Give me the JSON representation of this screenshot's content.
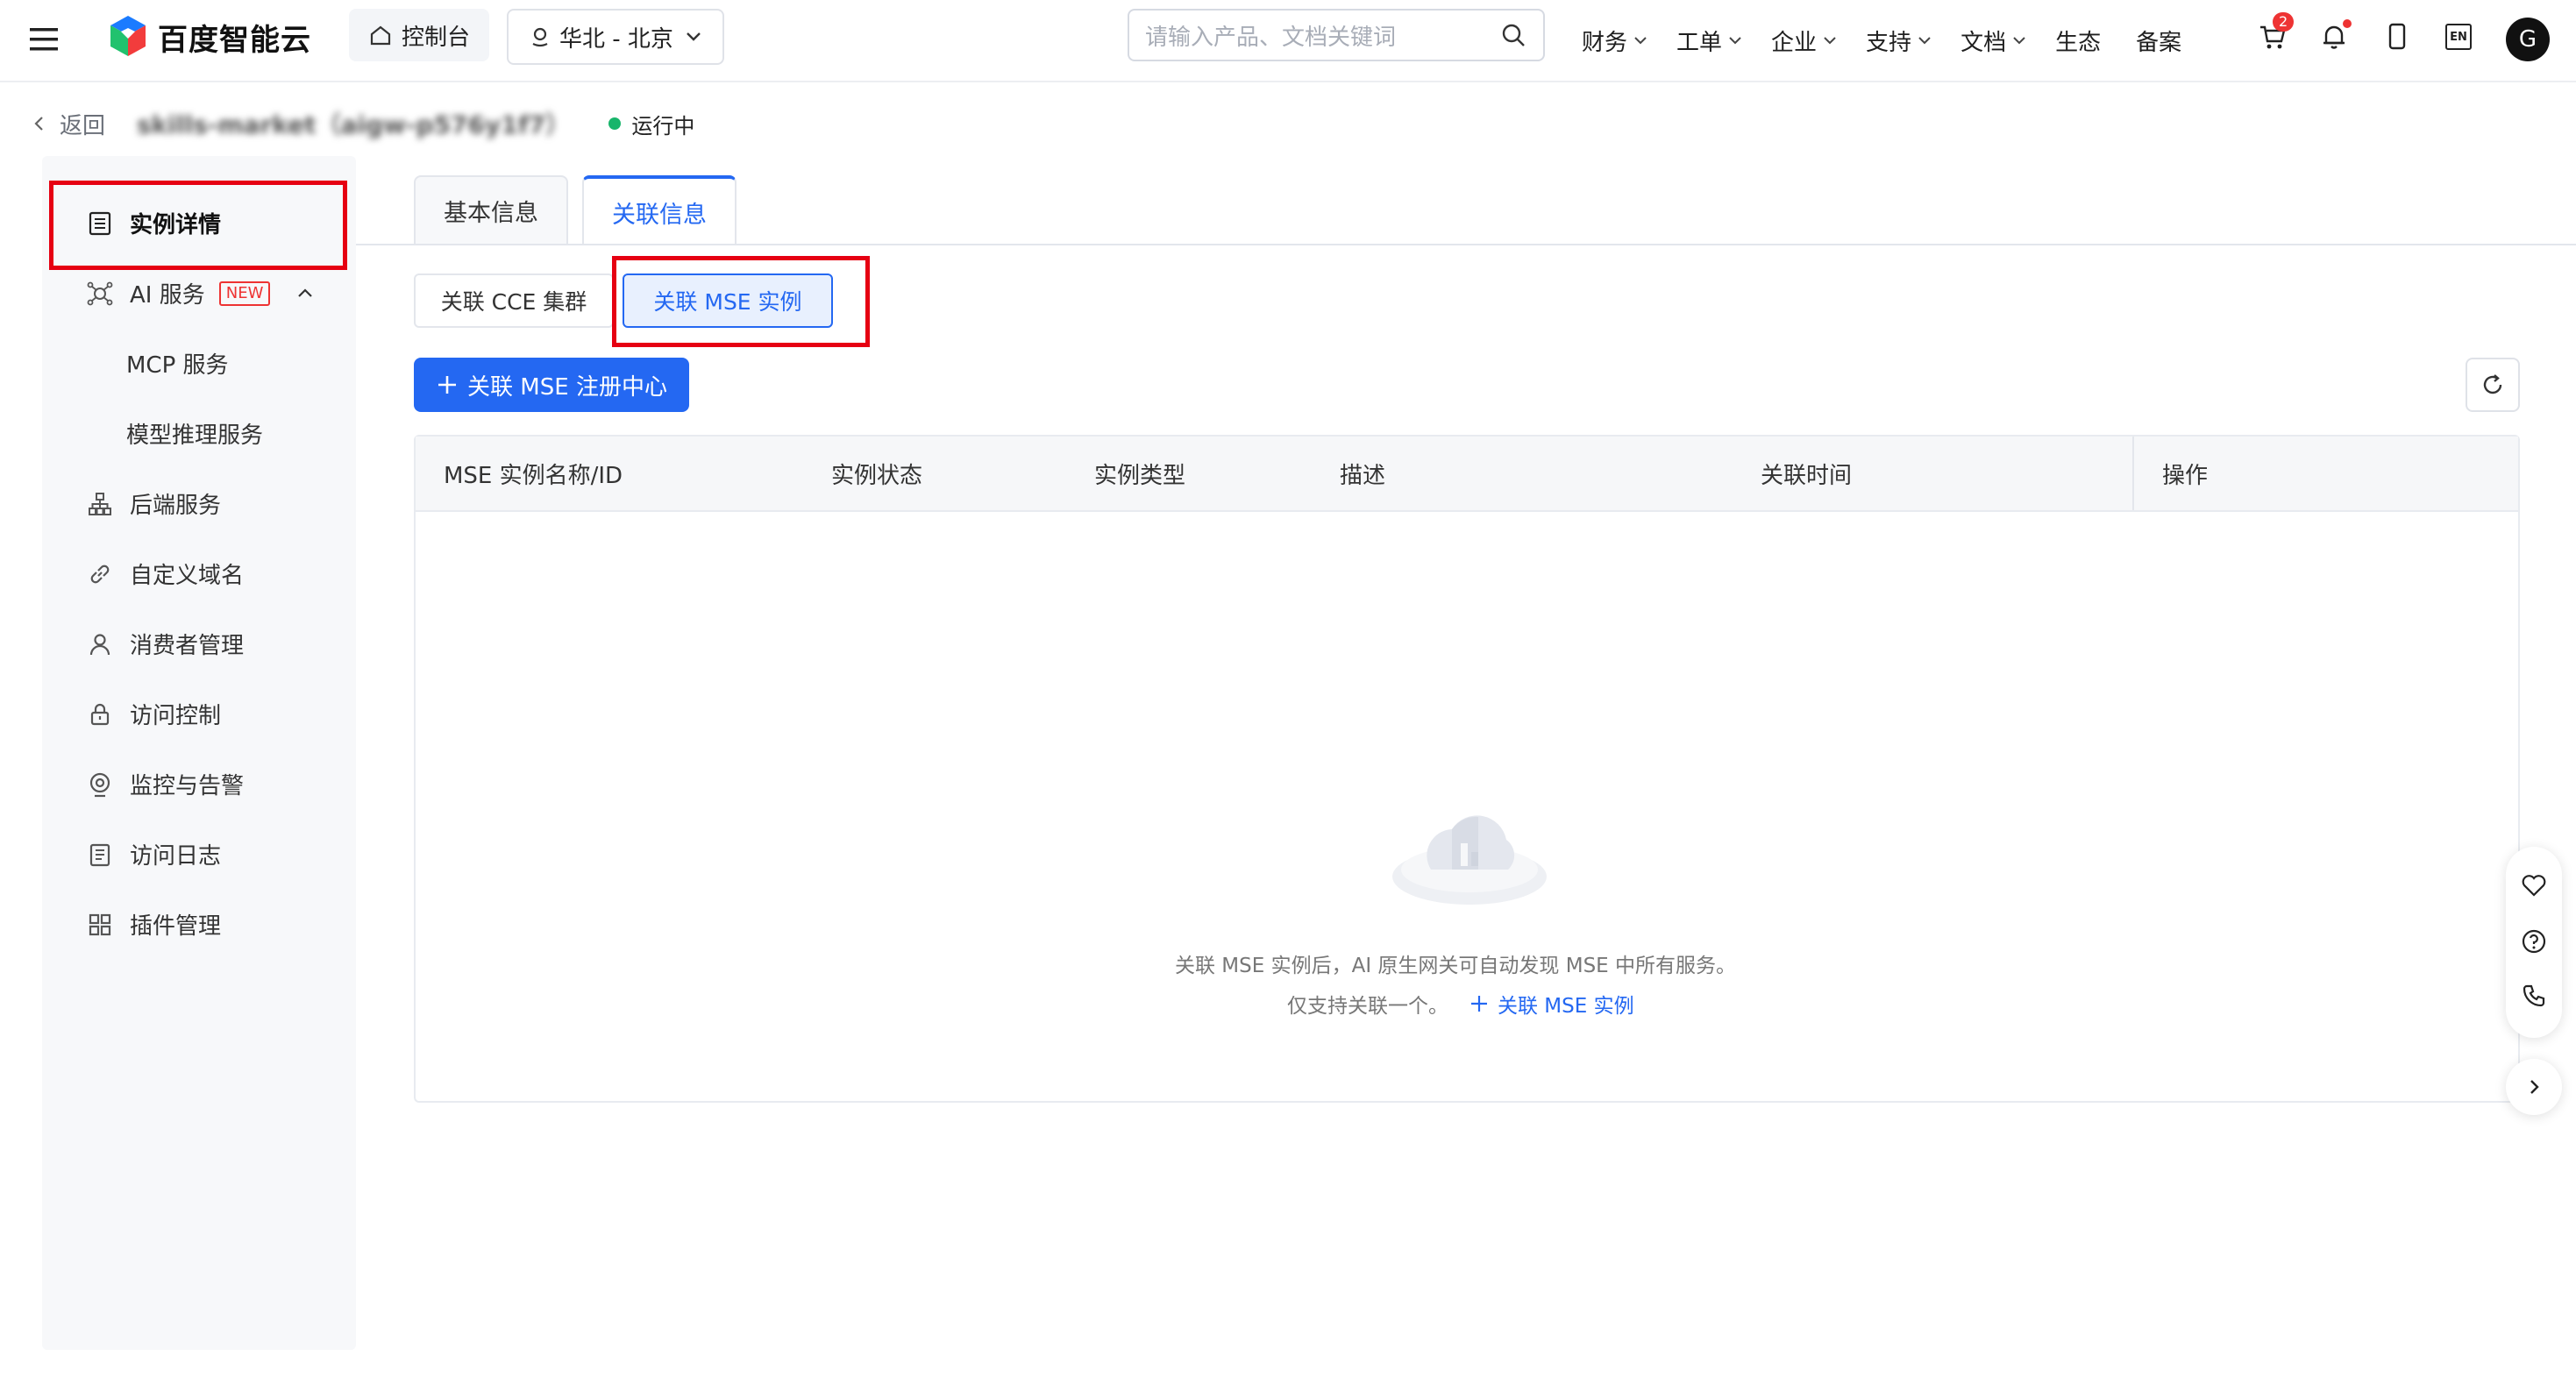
{
  "topbar": {
    "brand": "百度智能云",
    "console_label": "控制台",
    "region_label": "华北 - 北京",
    "search_placeholder": "请输入产品、文档关键词",
    "nav": [
      "财务",
      "工单",
      "企业",
      "支持",
      "文档",
      "生态",
      "备案"
    ],
    "cart_count": "2",
    "lang": "EN",
    "avatar_initial": "G"
  },
  "breadcrumb": {
    "back": "返回",
    "instance_name": "skills-market（aigw-p576y1f7）",
    "status": "运行中"
  },
  "sidebar": {
    "items": [
      {
        "label": "实例详情",
        "icon": "list-icon"
      },
      {
        "label": "AI 服务",
        "icon": "ai-icon",
        "badge": "NEW"
      },
      {
        "label": "MCP 服务"
      },
      {
        "label": "模型推理服务"
      },
      {
        "label": "后端服务",
        "icon": "hierarchy-icon"
      },
      {
        "label": "自定义域名",
        "icon": "link-icon"
      },
      {
        "label": "消费者管理",
        "icon": "user-icon"
      },
      {
        "label": "访问控制",
        "icon": "lock-icon"
      },
      {
        "label": "监控与告警",
        "icon": "monitor-icon"
      },
      {
        "label": "访问日志",
        "icon": "log-icon"
      },
      {
        "label": "插件管理",
        "icon": "grid-icon"
      }
    ]
  },
  "tabs": [
    "基本信息",
    "关联信息"
  ],
  "segments": [
    "关联 CCE 集群",
    "关联 MSE 实例"
  ],
  "primary_button": "关联 MSE 注册中心",
  "table": {
    "columns": [
      "MSE 实例名称/ID",
      "实例状态",
      "实例类型",
      "描述",
      "关联时间",
      "操作"
    ]
  },
  "empty": {
    "line1": "关联 MSE 实例后，AI 原生网关可自动发现 MSE 中所有服务。",
    "line2": "仅支持关联一个。",
    "link": "关联 MSE 实例"
  },
  "colors": {
    "primary": "#2468f2",
    "highlight_box": "#e60012",
    "status_green": "#18b56b"
  }
}
